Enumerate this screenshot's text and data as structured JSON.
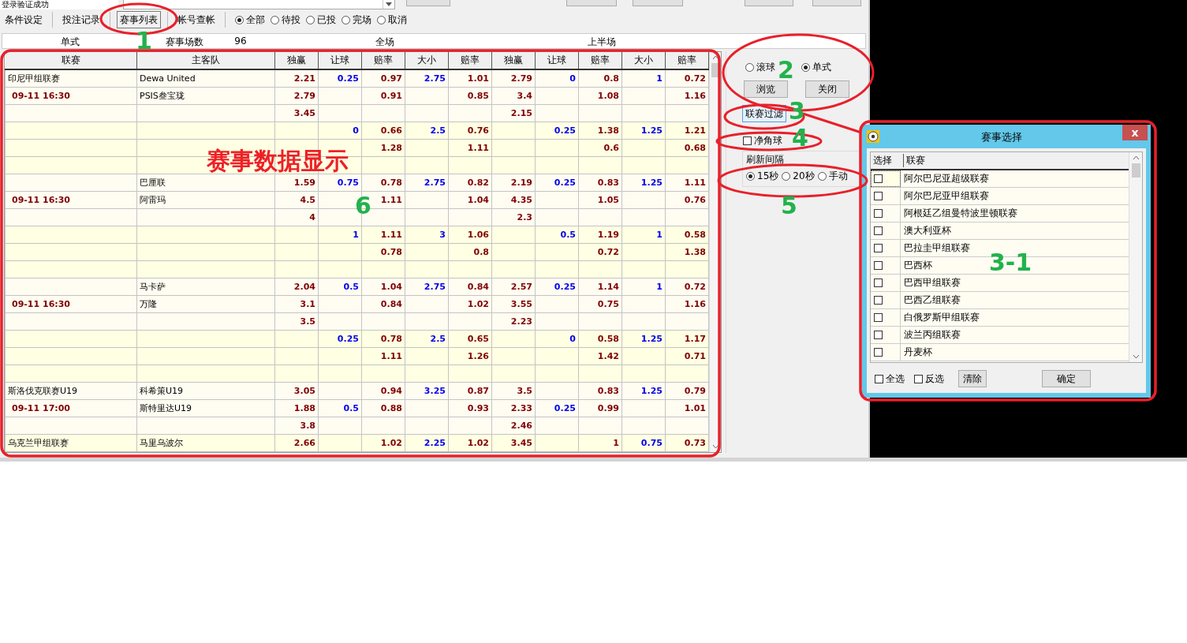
{
  "top_strip": {
    "status": "登录验证成功"
  },
  "tabs": [
    {
      "label": "条件设定",
      "selected": false
    },
    {
      "label": "投注记录",
      "selected": false
    },
    {
      "label": "赛事列表",
      "selected": true
    },
    {
      "label": "帐号查帐",
      "selected": false
    }
  ],
  "filters": [
    {
      "label": "全部",
      "selected": true
    },
    {
      "label": "待投",
      "selected": false
    },
    {
      "label": "已投",
      "selected": false
    },
    {
      "label": "完场",
      "selected": false
    },
    {
      "label": "取消",
      "selected": false
    }
  ],
  "summary": [
    "单式",
    "赛事场数",
    "96",
    "全场",
    "上半场"
  ],
  "table": {
    "columns": [
      {
        "label": "联赛",
        "kind": "text"
      },
      {
        "label": "主客队",
        "kind": "text"
      },
      {
        "label": "独赢",
        "kind": "odds"
      },
      {
        "label": "让球",
        "kind": "line"
      },
      {
        "label": "赔率",
        "kind": "odds"
      },
      {
        "label": "大小",
        "kind": "line"
      },
      {
        "label": "赔率",
        "kind": "odds"
      },
      {
        "label": "独赢",
        "kind": "odds"
      },
      {
        "label": "让球",
        "kind": "line"
      },
      {
        "label": "赔率",
        "kind": "odds"
      },
      {
        "label": "大小",
        "kind": "line"
      },
      {
        "label": "赔率",
        "kind": "odds"
      }
    ],
    "rows": [
      {
        "league": "印尼甲组联赛",
        "team": "Dewa United",
        "full": {
          "win": "2.21",
          "handicap": "0.25",
          "handicap_odds": "0.97",
          "total": "2.75",
          "total_odds": "1.01"
        },
        "half": {
          "win": "2.79",
          "handicap": "0",
          "handicap_odds": "0.8",
          "total": "1",
          "total_odds": "0.72"
        }
      },
      {
        "time": "09-11 16:30",
        "team": "PSIS叁宝珑",
        "full": {
          "win": "2.79",
          "handicap_odds": "0.91",
          "total_odds": "0.85"
        },
        "half": {
          "win": "3.4",
          "handicap_odds": "1.08",
          "total_odds": "1.16"
        }
      },
      {
        "full": {
          "win": "3.45"
        },
        "half": {
          "win": "2.15"
        }
      },
      {
        "full": {
          "handicap": "0",
          "handicap_odds": "0.66",
          "total": "2.5",
          "total_odds": "0.76"
        },
        "half": {
          "handicap": "0.25",
          "handicap_odds": "1.38",
          "total": "1.25",
          "total_odds": "1.21"
        }
      },
      {
        "full": {
          "handicap_odds": "1.28",
          "total_odds": "1.11"
        },
        "half": {
          "handicap_odds": "0.6",
          "total_odds": "0.68"
        }
      },
      {},
      {
        "team": "巴厘联",
        "full": {
          "win": "1.59",
          "handicap": "0.75",
          "handicap_odds": "0.78",
          "total": "2.75",
          "total_odds": "0.82"
        },
        "half": {
          "win": "2.19",
          "handicap": "0.25",
          "handicap_odds": "0.83",
          "total": "1.25",
          "total_odds": "1.11"
        }
      },
      {
        "time": "09-11 16:30",
        "team": "阿雷玛",
        "full": {
          "win": "4.5",
          "handicap_odds": "1.11",
          "total_odds": "1.04"
        },
        "half": {
          "win": "4.35",
          "handicap_odds": "1.05",
          "total_odds": "0.76"
        }
      },
      {
        "full": {
          "win": "4"
        },
        "half": {
          "win": "2.3"
        }
      },
      {
        "full": {
          "handicap": "1",
          "handicap_odds": "1.11",
          "total": "3",
          "total_odds": "1.06"
        },
        "half": {
          "handicap": "0.5",
          "handicap_odds": "1.19",
          "total": "1",
          "total_odds": "0.58"
        }
      },
      {
        "full": {
          "handicap_odds": "0.78",
          "total_odds": "0.8"
        },
        "half": {
          "handicap_odds": "0.72",
          "total_odds": "1.38"
        }
      },
      {},
      {
        "team": "马卡萨",
        "full": {
          "win": "2.04",
          "handicap": "0.5",
          "handicap_odds": "1.04",
          "total": "2.75",
          "total_odds": "0.84"
        },
        "half": {
          "win": "2.57",
          "handicap": "0.25",
          "handicap_odds": "1.14",
          "total": "1",
          "total_odds": "0.72"
        }
      },
      {
        "time": "09-11 16:30",
        "team": "万隆",
        "full": {
          "win": "3.1",
          "handicap_odds": "0.84",
          "total_odds": "1.02"
        },
        "half": {
          "win": "3.55",
          "handicap_odds": "0.75",
          "total_odds": "1.16"
        }
      },
      {
        "full": {
          "win": "3.5"
        },
        "half": {
          "win": "2.23"
        }
      },
      {
        "full": {
          "handicap": "0.25",
          "handicap_odds": "0.78",
          "total": "2.5",
          "total_odds": "0.65"
        },
        "half": {
          "handicap": "0",
          "handicap_odds": "0.58",
          "total": "1.25",
          "total_odds": "1.17"
        }
      },
      {
        "full": {
          "handicap_odds": "1.11",
          "total_odds": "1.26"
        },
        "half": {
          "handicap_odds": "1.42",
          "total_odds": "0.71"
        }
      },
      {},
      {
        "league": "斯洛伐克联赛U19",
        "team": "科希策U19",
        "full": {
          "win": "3.05",
          "handicap_odds": "0.94",
          "total": "3.25",
          "total_odds": "0.87"
        },
        "half": {
          "win": "3.5",
          "handicap_odds": "0.83",
          "total": "1.25",
          "total_odds": "0.79"
        }
      },
      {
        "time": "09-11 17:00",
        "team": "斯特里达U19",
        "full": {
          "win": "1.88",
          "handicap": "0.5",
          "handicap_odds": "0.88",
          "total_odds": "0.93"
        },
        "half": {
          "win": "2.33",
          "handicap": "0.25",
          "handicap_odds": "0.99",
          "total_odds": "1.01"
        }
      },
      {
        "full": {
          "win": "3.8"
        },
        "half": {
          "win": "2.46"
        }
      },
      {
        "league": "乌克兰甲组联赛",
        "team": "马里乌波尔",
        "full": {
          "win": "2.66",
          "handicap_odds": "1.02",
          "total": "2.25",
          "total_odds": "1.02"
        },
        "half": {
          "win": "3.45",
          "handicap_odds": "1",
          "total": "0.75",
          "total_odds": "0.73"
        }
      }
    ]
  },
  "side": {
    "modes": [
      {
        "label": "滚球",
        "selected": false
      },
      {
        "label": "单式",
        "selected": true
      }
    ],
    "buttons": [
      "浏览",
      "关闭"
    ],
    "filter_button": "联赛过滤",
    "corner": {
      "label": "净角球",
      "checked": false
    },
    "refresh": {
      "title": "刷新间隔",
      "options": [
        {
          "label": "15秒",
          "selected": true
        },
        {
          "label": "20秒",
          "selected": false
        },
        {
          "label": "手动",
          "selected": false
        }
      ]
    }
  },
  "dialog": {
    "title": "赛事选择",
    "close": "x",
    "columns": [
      "选择",
      "联赛"
    ],
    "items": [
      {
        "label": "阿尔巴尼亚超级联赛",
        "checked": false
      },
      {
        "label": "阿尔巴尼亚甲组联赛",
        "checked": false
      },
      {
        "label": "阿根廷乙组曼特波里顿联赛",
        "checked": false
      },
      {
        "label": "澳大利亚杯",
        "checked": false
      },
      {
        "label": "巴拉圭甲组联赛",
        "checked": false
      },
      {
        "label": "巴西杯",
        "checked": false
      },
      {
        "label": "巴西甲组联赛",
        "checked": false
      },
      {
        "label": "巴西乙组联赛",
        "checked": false
      },
      {
        "label": "白俄罗斯甲组联赛",
        "checked": false
      },
      {
        "label": "波兰丙组联赛",
        "checked": false
      },
      {
        "label": "丹麦杯",
        "checked": false
      }
    ],
    "select_all": {
      "label": "全选",
      "checked": false
    },
    "invert": {
      "label": "反选",
      "checked": false
    },
    "clear": "清除",
    "ok": "确定"
  },
  "annotations": {
    "caption": "赛事数据显示",
    "markers": [
      "1",
      "2",
      "3",
      "4",
      "5",
      "6",
      "3-1"
    ]
  }
}
